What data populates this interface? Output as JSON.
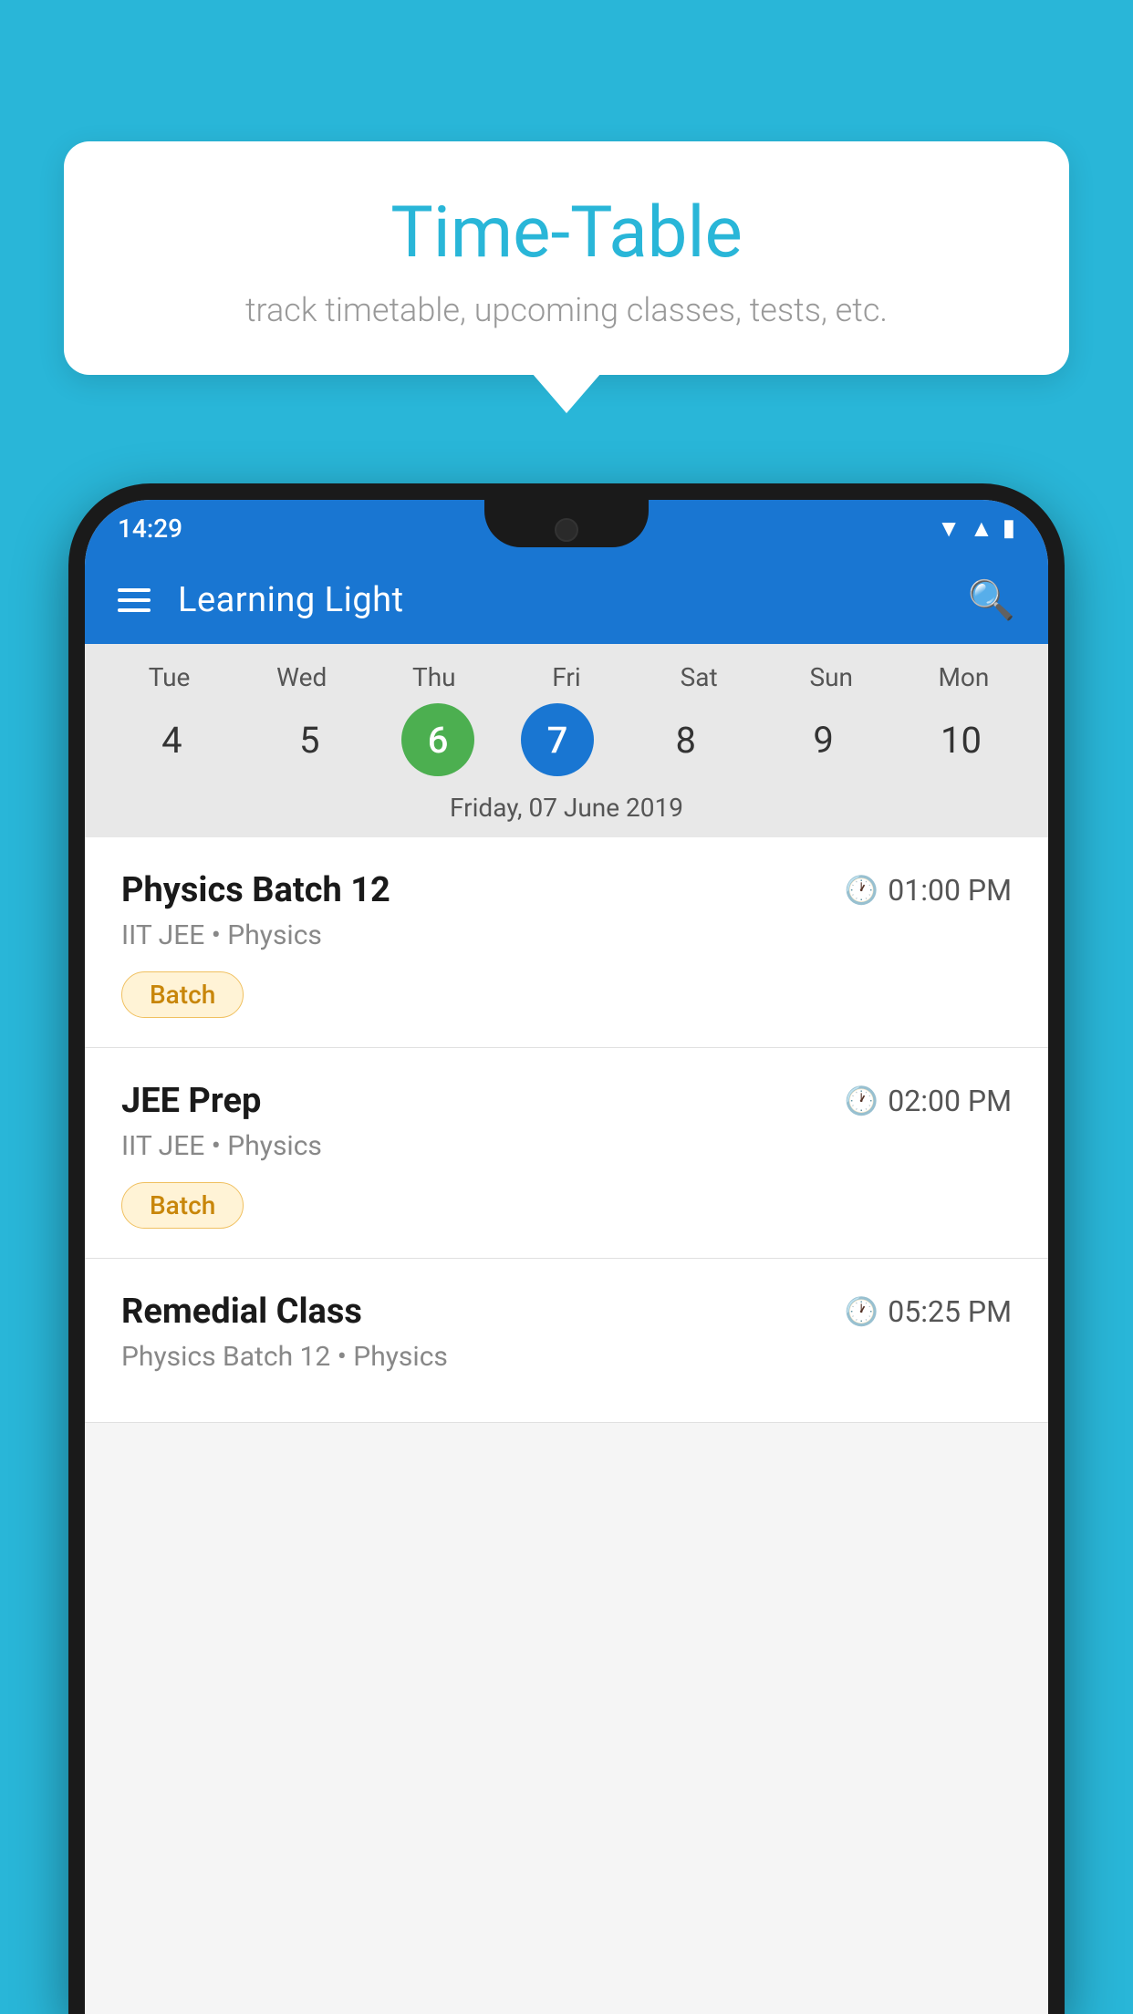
{
  "background": {
    "color": "#29b6d8"
  },
  "tooltip": {
    "title": "Time-Table",
    "subtitle": "track timetable, upcoming classes, tests, etc."
  },
  "phone": {
    "status_bar": {
      "time": "14:29"
    },
    "app_bar": {
      "title": "Learning Light"
    },
    "calendar": {
      "days": [
        {
          "label": "Tue",
          "number": "4"
        },
        {
          "label": "Wed",
          "number": "5"
        },
        {
          "label": "Thu",
          "number": "6",
          "state": "today"
        },
        {
          "label": "Fri",
          "number": "7",
          "state": "selected"
        },
        {
          "label": "Sat",
          "number": "8"
        },
        {
          "label": "Sun",
          "number": "9"
        },
        {
          "label": "Mon",
          "number": "10"
        }
      ],
      "selected_date_label": "Friday, 07 June 2019"
    },
    "schedule": [
      {
        "name": "Physics Batch 12",
        "time": "01:00 PM",
        "sub": "IIT JEE • Physics",
        "badge": "Batch"
      },
      {
        "name": "JEE Prep",
        "time": "02:00 PM",
        "sub": "IIT JEE • Physics",
        "badge": "Batch"
      },
      {
        "name": "Remedial Class",
        "time": "05:25 PM",
        "sub": "Physics Batch 12 • Physics",
        "badge": null
      }
    ]
  }
}
